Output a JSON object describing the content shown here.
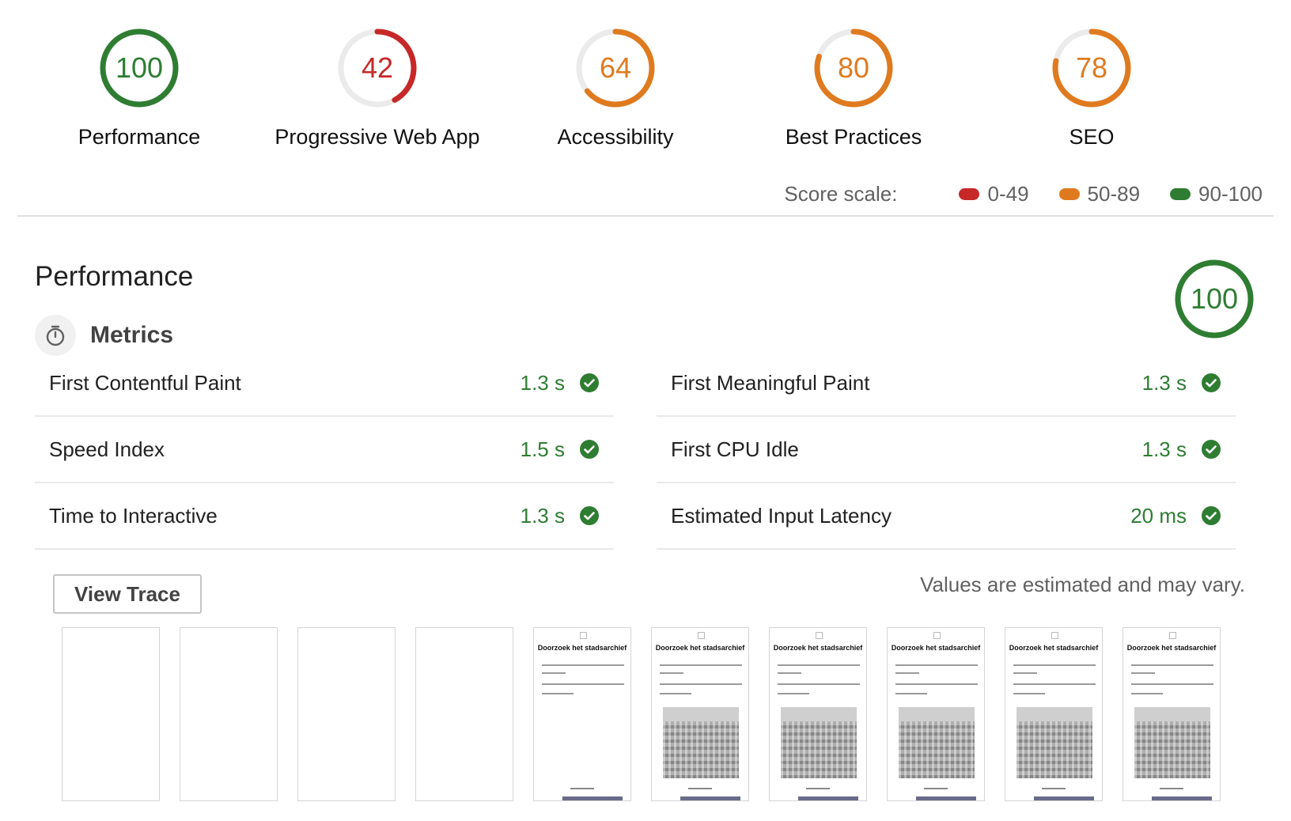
{
  "colors": {
    "fail": "#c62828",
    "average": "#e07a1f",
    "pass": "#2e7d32",
    "track": "#ebebeb"
  },
  "gauges": [
    {
      "score": "100",
      "label": "Performance",
      "fraction": 1.0,
      "color": "#2e7d32"
    },
    {
      "score": "42",
      "label": "Progressive Web App",
      "fraction": 0.42,
      "color": "#c62828"
    },
    {
      "score": "64",
      "label": "Accessibility",
      "fraction": 0.64,
      "color": "#e07a1f"
    },
    {
      "score": "80",
      "label": "Best Practices",
      "fraction": 0.8,
      "color": "#e07a1f"
    },
    {
      "score": "78",
      "label": "SEO",
      "fraction": 0.78,
      "color": "#e07a1f"
    }
  ],
  "score_scale": {
    "label": "Score scale:",
    "ranges": [
      {
        "label": "0-49",
        "color": "#c62828"
      },
      {
        "label": "50-89",
        "color": "#e07a1f"
      },
      {
        "label": "90-100",
        "color": "#2e7d32"
      }
    ]
  },
  "performance": {
    "title": "Performance",
    "score": "100",
    "fraction": 1.0,
    "metrics_title": "Metrics",
    "timer_icon": "stopwatch-icon",
    "metrics": [
      {
        "name": "First Contentful Paint",
        "value": "1.3 s"
      },
      {
        "name": "First Meaningful Paint",
        "value": "1.3 s"
      },
      {
        "name": "Speed Index",
        "value": "1.5 s"
      },
      {
        "name": "First CPU Idle",
        "value": "1.3 s"
      },
      {
        "name": "Time to Interactive",
        "value": "1.3 s"
      },
      {
        "name": "Estimated Input Latency",
        "value": "20 ms"
      }
    ],
    "pass_icon": "check-circle-icon",
    "view_trace_label": "View Trace",
    "note": "Values are estimated and may vary."
  },
  "filmstrip": {
    "frames": [
      {
        "state": "blank"
      },
      {
        "state": "blank"
      },
      {
        "state": "blank"
      },
      {
        "state": "blank"
      },
      {
        "state": "text",
        "heading": "Doorzoek het stadsarchief"
      },
      {
        "state": "full",
        "heading": "Doorzoek het stadsarchief"
      },
      {
        "state": "full",
        "heading": "Doorzoek het stadsarchief"
      },
      {
        "state": "full",
        "heading": "Doorzoek het stadsarchief"
      },
      {
        "state": "full",
        "heading": "Doorzoek het stadsarchief"
      },
      {
        "state": "full",
        "heading": "Doorzoek het stadsarchief"
      }
    ]
  }
}
